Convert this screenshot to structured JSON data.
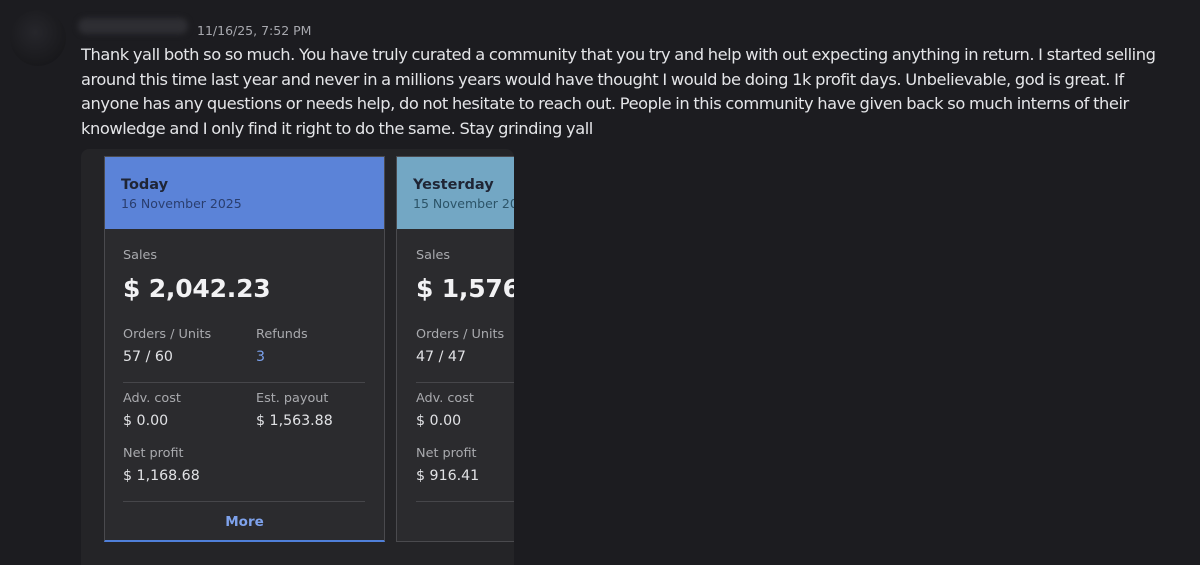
{
  "message": {
    "timestamp": "11/16/25, 7:52 PM",
    "text": "Thank yall both so so much. You have truly curated a community that you try and help with out expecting anything in return. I started selling around this time last year and never in a millions years would have thought I would be doing 1k profit days. Unbelievable, god is great. If anyone has any questions or needs help, do not hesitate to reach out. People in this community have given back so much interns of their knowledge and I only find it right to do the same. Stay grinding yall"
  },
  "today": {
    "title": "Today",
    "date": "16 November 2025",
    "sales_label": "Sales",
    "sales_value": "$ 2,042.23",
    "orders_label": "Orders / Units",
    "orders_value": "57 / 60",
    "refunds_label": "Refunds",
    "refunds_value": "3",
    "adv_label": "Adv. cost",
    "adv_value": "$ 0.00",
    "payout_label": "Est. payout",
    "payout_value": "$ 1,563.88",
    "net_label": "Net profit",
    "net_value": "$ 1,168.68",
    "more_label": "More"
  },
  "yesterday": {
    "title": "Yesterday",
    "date": "15 November 20",
    "sales_label": "Sales",
    "sales_value": "$ 1,576.",
    "orders_label": "Orders / Units",
    "orders_value": "47 / 47",
    "adv_label": "Adv. cost",
    "adv_value": "$ 0.00",
    "net_label": "Net profit",
    "net_value": "$ 916.41"
  },
  "colors": {
    "today_header": "#5b83d8",
    "yesterday_header": "#73a7c4",
    "link": "#7aa0ea"
  }
}
